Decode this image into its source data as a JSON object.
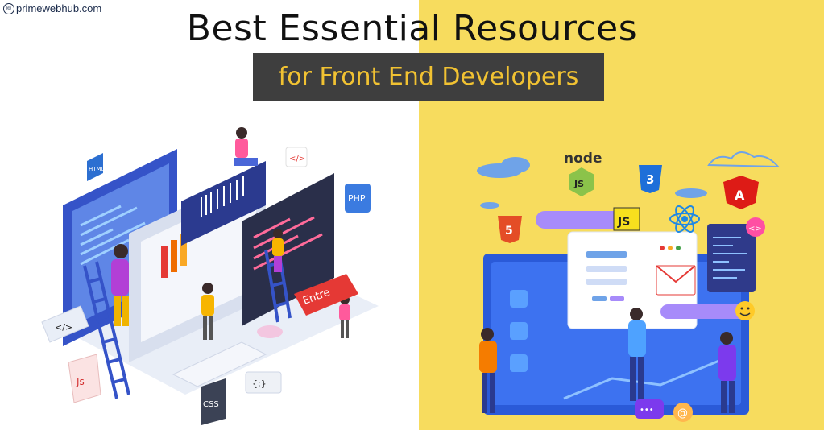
{
  "brand": {
    "name": "primewebhub.com",
    "copyright_symbol": "©"
  },
  "heading": {
    "title": "Best Essential Resources",
    "subtitle": "for Front End Developers"
  },
  "colors": {
    "left_background": "#ffffff",
    "right_background": "#f7dc5e",
    "subtitle_box": "#3e3e3e",
    "subtitle_text": "#f1c232"
  },
  "left_illustration": {
    "tags": {
      "html": "HTML",
      "php": "PHP",
      "code": "</>",
      "code_small": "</>",
      "js": "Js",
      "css": "CSS",
      "braces": "{;}",
      "enter": "Entre"
    }
  },
  "right_illustration": {
    "tags": {
      "node": "node",
      "node_js": "JS",
      "css3": "3",
      "js": "JS",
      "html5": "5",
      "angular": "A",
      "code": "<>",
      "at": "@",
      "chat": "•••"
    }
  }
}
